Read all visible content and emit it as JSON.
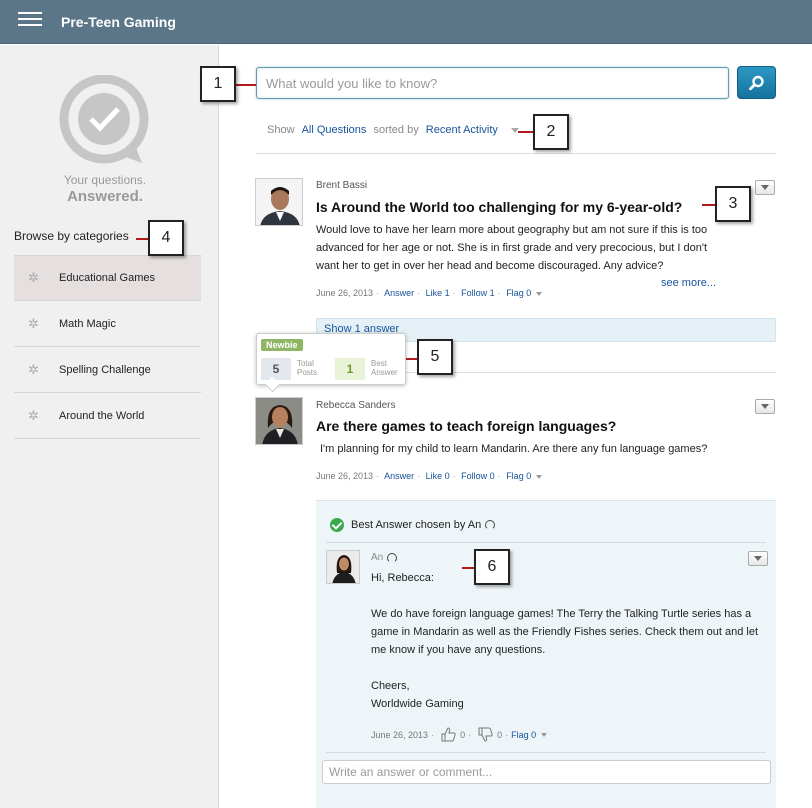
{
  "header": {
    "title": "Pre-Teen Gaming",
    "menu_icon": "hamburger-menu-icon"
  },
  "sidebar": {
    "tagline_line1": "Your questions.",
    "tagline_line2": "Answered.",
    "browse_label": "Browse by categories",
    "categories": [
      {
        "label": "Educational Games",
        "active": true
      },
      {
        "label": "Math Magic",
        "active": false
      },
      {
        "label": "Spelling Challenge",
        "active": false
      },
      {
        "label": "Around the World",
        "active": false
      }
    ]
  },
  "search": {
    "placeholder": "What would you like to know?",
    "value": ""
  },
  "filter": {
    "show_label": "Show",
    "show_value": "All Questions",
    "sorted_label": "sorted by",
    "sort_value": "Recent Activity"
  },
  "questions": [
    {
      "author": "Brent Bassi",
      "title": "Is Around the World too challenging for my 6-year-old?",
      "body_lines": [
        "Would love to have her learn more about geography but am not sure if this is too",
        "advanced for her age or not. She is in first grade and very precocious, but I don't",
        "want her to get in over her head and become discouraged. Any advice?"
      ],
      "see_more": "see more...",
      "date": "June 26, 2013",
      "answer": "Answer",
      "like": "Like 1",
      "follow": "Follow 1",
      "flag": "Flag 0",
      "show_answers": "Show 1 answer"
    },
    {
      "author": "Rebecca Sanders",
      "title": "Are there games to teach foreign languages?",
      "body": "I'm planning for my child to learn Mandarin. Are there any fun language games?",
      "date": "June 26, 2013",
      "answer": "Answer",
      "like": "Like 0",
      "follow": "Follow 0",
      "flag": "Flag 0"
    }
  ],
  "hover_card": {
    "badge": "Newbie",
    "total_posts": "5",
    "total_posts_label_1": "Total",
    "total_posts_label_2": "Posts",
    "best_answer": "1",
    "best_answer_label_1": "Best",
    "best_answer_label_2": "Answer"
  },
  "best_answer": {
    "header": "Best Answer chosen by An",
    "author": "An",
    "greeting": "Hi, Rebecca:",
    "body": "We do have foreign language games! The Terry the Talking Turtle series has a game in Mandarin as well as the Friendly Fishes series. Check them out and let me know if you have any questions.",
    "signoff": "Cheers,",
    "signature": "Worldwide Gaming",
    "date": "June 26, 2013",
    "likes": "0",
    "dislikes": "0",
    "flag": "Flag 0"
  },
  "comment": {
    "placeholder": "Write an answer or comment..."
  },
  "callouts": [
    "1",
    "2",
    "3",
    "4",
    "5",
    "6"
  ],
  "colors": {
    "header_bg": "#5c7689",
    "link": "#16539b",
    "search_button": "#1b80ae",
    "badge": "#8fb665",
    "best_answer_bg": "#eef5f9",
    "callout_line": "#b01a1a"
  }
}
